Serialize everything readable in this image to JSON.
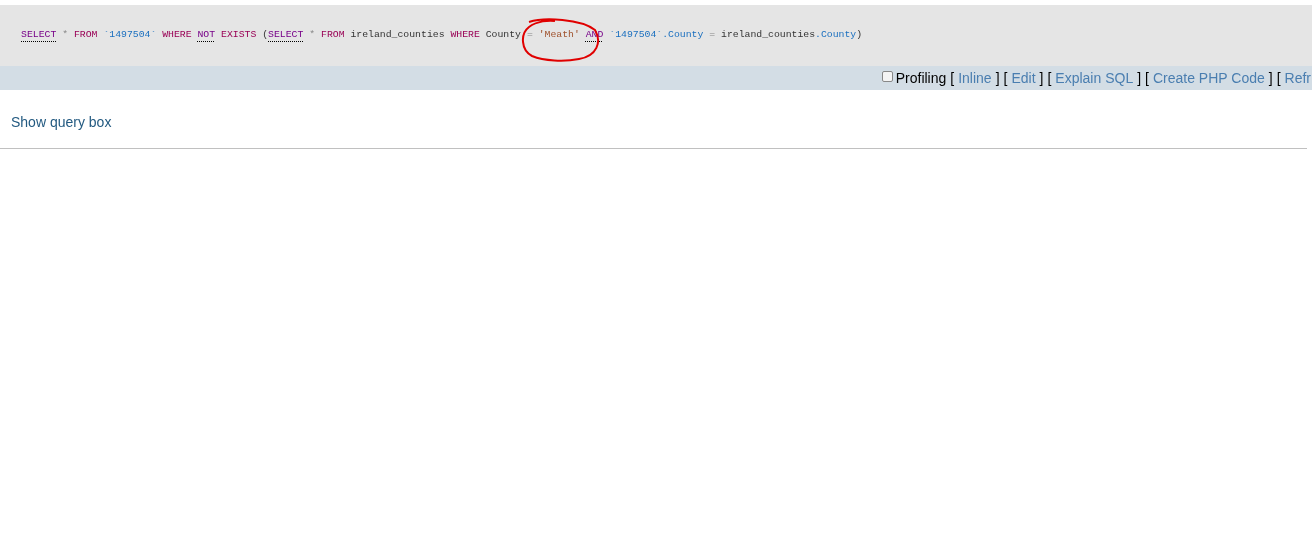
{
  "sql_query": {
    "words": [
      [
        {
          "kind": "link",
          "text": "SELECT"
        }
      ],
      [
        {
          "kind": "operator",
          "text": "*"
        }
      ],
      [
        {
          "kind": "keyword",
          "text": "FROM"
        }
      ],
      [
        {
          "kind": "quoted",
          "text": "`1497504`"
        }
      ],
      [
        {
          "kind": "keyword",
          "text": "WHERE"
        }
      ],
      [
        {
          "kind": "link",
          "text": "NOT"
        }
      ],
      [
        {
          "kind": "keyword",
          "text": "EXISTS"
        }
      ],
      [
        {
          "kind": "punct",
          "text": "("
        },
        {
          "kind": "link",
          "text": "SELECT"
        }
      ],
      [
        {
          "kind": "operator",
          "text": "*"
        }
      ],
      [
        {
          "kind": "keyword",
          "text": "FROM"
        }
      ],
      [
        {
          "kind": "name",
          "text": "ireland_counties"
        }
      ],
      [
        {
          "kind": "keyword",
          "text": "WHERE"
        }
      ],
      [
        {
          "kind": "name",
          "text": "County"
        }
      ],
      [
        {
          "kind": "operator",
          "text": "="
        }
      ],
      [
        {
          "kind": "string",
          "text": "'Meath'"
        }
      ],
      [
        {
          "kind": "link",
          "text": "AND"
        }
      ],
      [
        {
          "kind": "quoted",
          "text": "`1497504`"
        },
        {
          "kind": "quoted",
          "text": ".County"
        }
      ],
      [
        {
          "kind": "operator",
          "text": "="
        }
      ],
      [
        {
          "kind": "name",
          "text": "ireland_counties"
        },
        {
          "kind": "quoted",
          "text": ".County"
        },
        {
          "kind": "punct",
          "text": ")"
        }
      ]
    ]
  },
  "toolbar": {
    "profiling": {
      "label": "Profiling",
      "checked": false
    },
    "links": [
      {
        "open": "[",
        "text": "Inline",
        "close": "]"
      },
      {
        "open": "[",
        "text": "Edit",
        "close": "]"
      },
      {
        "open": "[",
        "text": "Explain SQL",
        "close": "]"
      },
      {
        "open": "[",
        "text": "Create PHP Code",
        "close": "]"
      },
      {
        "open": "[",
        "text": "Refr"
      }
    ]
  },
  "show_query_box": "Show query box"
}
